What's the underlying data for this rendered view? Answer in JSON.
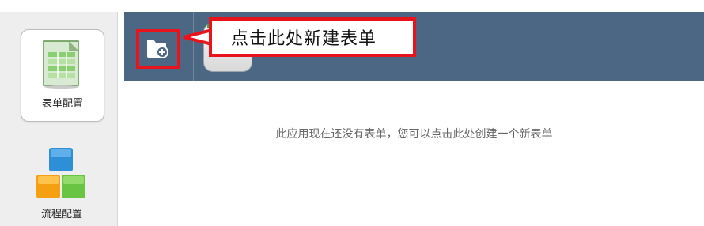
{
  "sidebar": {
    "items": [
      {
        "label": "表单配置",
        "icon": "form-sheet-icon",
        "active": true
      },
      {
        "label": "流程配置",
        "icon": "process-blocks-icon",
        "active": false
      }
    ]
  },
  "toolbar": {
    "new_button_icon": "folder-add-icon",
    "callout_text": "点击此处新建表单",
    "highlight_color": "#e8131b",
    "background_color": "#4c6783"
  },
  "main": {
    "empty_message": "此应用现在还没有表单，您可以点击此处创建一个新表单"
  }
}
